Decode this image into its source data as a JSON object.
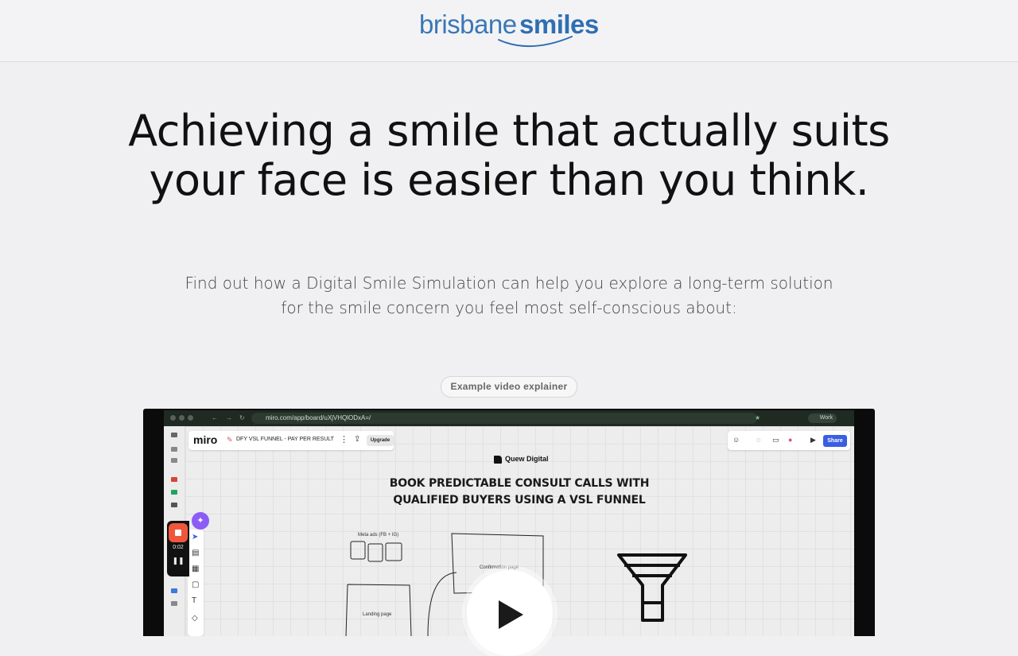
{
  "header": {
    "logo_part1": "brisbane",
    "logo_part2": "smiles",
    "logo_color": "#2f6fb3"
  },
  "hero": {
    "headline": "Achieving a smile that actually suits your face is easier than you think.",
    "subheadline": "Find out how a Digital Smile Simulation can help you explore a long-term solution for the smile concern you feel most self-conscious about:",
    "video_label": "Example video explainer"
  },
  "video": {
    "browser_url": "miro.com/app/board/uXjVHQlODxA=/",
    "profile_label": "Work",
    "miro": {
      "logo": "miro",
      "board_name": "DFY VSL FUNNEL - PAY PER RESULT",
      "upgrade_label": "Upgrade",
      "share_label": "Share",
      "brand": "Quew Digital",
      "board_title_line1": "BOOK PREDICTABLE CONSULT CALLS WITH",
      "board_title_line2": "QUALIFIED BUYERS USING A VSL FUNNEL",
      "sketch_labels": {
        "meta_ads": "Meta ads (FB + IG)",
        "confirmation": "Confirmation page",
        "landing": "Landing page"
      }
    },
    "recorder": {
      "time": "0:02"
    },
    "play_icon": "play-icon"
  },
  "colors": {
    "share_button": "#3a5fe0",
    "record_button": "#f0573a",
    "ai_button": "#8b5cf6"
  }
}
